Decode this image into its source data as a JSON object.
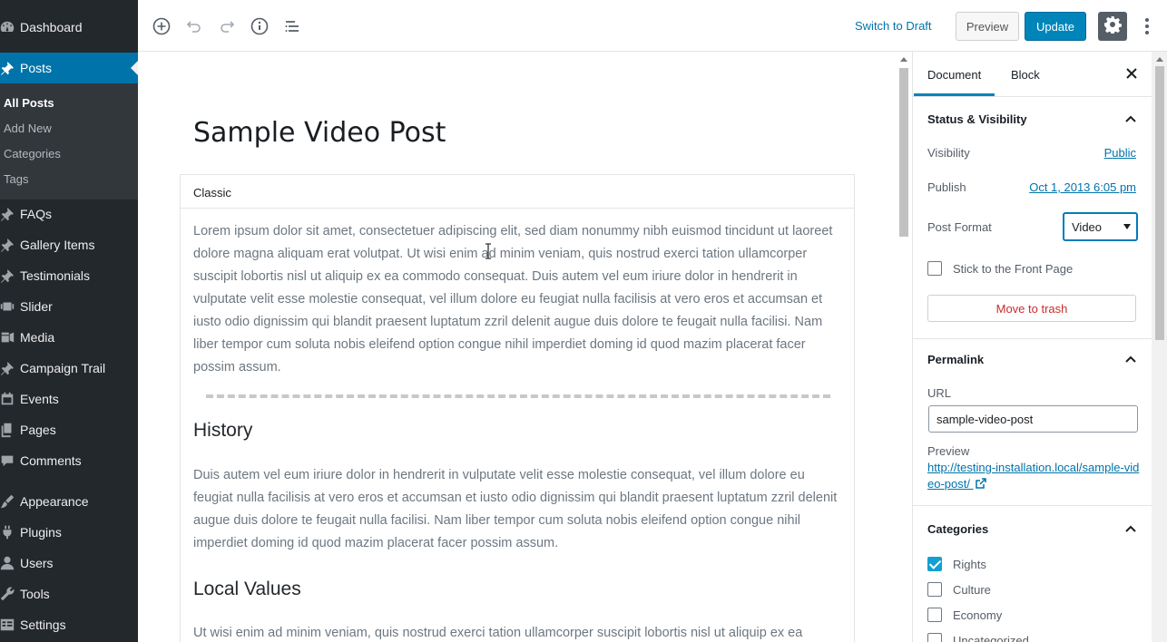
{
  "sidebar": {
    "items": [
      {
        "id": "dashboard",
        "label": "Dashboard",
        "icon": "dashboard-icon"
      },
      {
        "id": "posts",
        "label": "Posts",
        "icon": "pin-icon",
        "active": true
      },
      {
        "id": "faqs",
        "label": "FAQs",
        "icon": "pin-icon"
      },
      {
        "id": "gallery",
        "label": "Gallery Items",
        "icon": "pin-icon"
      },
      {
        "id": "testimonials",
        "label": "Testimonials",
        "icon": "pin-icon"
      },
      {
        "id": "slider",
        "label": "Slider",
        "icon": "slides-icon"
      },
      {
        "id": "media",
        "label": "Media",
        "icon": "media-icon"
      },
      {
        "id": "campaign",
        "label": "Campaign Trail",
        "icon": "pin-icon"
      },
      {
        "id": "events",
        "label": "Events",
        "icon": "calendar-icon"
      },
      {
        "id": "pages",
        "label": "Pages",
        "icon": "pages-icon"
      },
      {
        "id": "comments",
        "label": "Comments",
        "icon": "comment-icon"
      },
      {
        "id": "appearance",
        "label": "Appearance",
        "icon": "brush-icon"
      },
      {
        "id": "plugins",
        "label": "Plugins",
        "icon": "plug-icon"
      },
      {
        "id": "users",
        "label": "Users",
        "icon": "user-icon"
      },
      {
        "id": "tools",
        "label": "Tools",
        "icon": "wrench-icon"
      },
      {
        "id": "settings",
        "label": "Settings",
        "icon": "settings-icon"
      }
    ],
    "submenu": [
      "All Posts",
      "Add New",
      "Categories",
      "Tags"
    ]
  },
  "toolbar": {
    "switch_draft": "Switch to Draft",
    "preview": "Preview",
    "update": "Update"
  },
  "editor": {
    "title": "Sample Video Post",
    "block_label": "Classic",
    "para1": "Lorem ipsum dolor sit amet, consectetuer adipiscing elit, sed diam nonummy nibh euismod tincidunt ut laoreet dolore magna aliquam erat volutpat. Ut wisi enim ad minim veniam, quis nostrud exerci tation ullamcorper suscipit lobortis nisl ut aliquip ex ea commodo consequat. Duis autem vel eum iriure dolor in hendrerit in vulputate velit esse molestie consequat, vel illum dolore eu feugiat nulla facilisis at vero eros et accumsan et iusto odio dignissim qui blandit praesent luptatum zzril delenit augue duis dolore te feugait nulla facilisi. Nam liber tempor cum soluta nobis eleifend option congue nihil imperdiet doming id quod mazim placerat facer possim assum.",
    "heading1": "History",
    "para2": "Duis autem vel eum iriure dolor in hendrerit in vulputate velit esse molestie consequat, vel illum dolore eu feugiat nulla facilisis at vero eros et accumsan et iusto odio dignissim qui blandit praesent luptatum zzril delenit augue duis dolore te feugait nulla facilisi. Nam liber tempor cum soluta nobis eleifend option congue nihil imperdiet doming id quod mazim placerat facer possim assum.",
    "heading2": "Local Values",
    "para3": "Ut wisi enim ad minim veniam, quis nostrud exerci tation ullamcorper suscipit lobortis nisl ut aliquip ex ea"
  },
  "settings": {
    "tab_document": "Document",
    "tab_block": "Block",
    "status_title": "Status & Visibility",
    "visibility_label": "Visibility",
    "visibility_value": "Public",
    "publish_label": "Publish",
    "publish_value": "Oct 1, 2013 6:05 pm",
    "format_label": "Post Format",
    "format_value": "Video",
    "sticky_label": "Stick to the Front Page",
    "sticky_checked": false,
    "trash": "Move to trash",
    "permalink_title": "Permalink",
    "url_label": "URL",
    "url_value": "sample-video-post",
    "preview_label": "Preview",
    "preview_link": "http://testing-installation.local/sample-video-post/",
    "categories_title": "Categories",
    "categories": [
      {
        "label": "Rights",
        "checked": true
      },
      {
        "label": "Culture",
        "checked": false
      },
      {
        "label": "Economy",
        "checked": false
      },
      {
        "label": "Uncategorized",
        "checked": false
      }
    ]
  },
  "colors": {
    "admin_bg": "#23282d",
    "accent": "#0073aa",
    "update_bg": "#0085ba",
    "trash": "#c92c2c"
  }
}
